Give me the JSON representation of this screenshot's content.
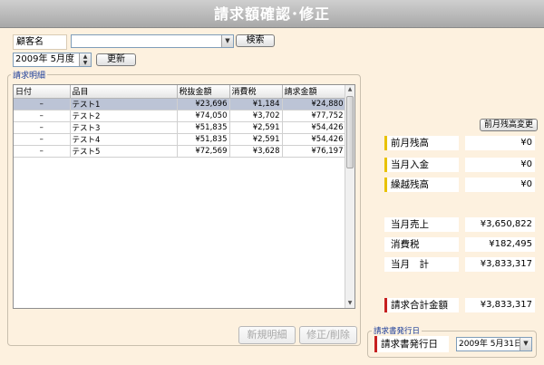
{
  "window": {
    "title": "請求額確認･修正"
  },
  "customer": {
    "label": "顧客名",
    "value": "",
    "search_button": "検索"
  },
  "period": {
    "value": "2009年 5月度",
    "refresh_button": "更新"
  },
  "detail": {
    "legend": "請求明細",
    "columns": [
      "日付",
      "品目",
      "税抜金額",
      "消費税",
      "請求金額"
    ],
    "rows": [
      {
        "date": "–",
        "item": "テスト1",
        "net": "¥23,696",
        "tax": "¥1,184",
        "total": "¥24,880"
      },
      {
        "date": "–",
        "item": "テスト2",
        "net": "¥74,050",
        "tax": "¥3,702",
        "total": "¥77,752"
      },
      {
        "date": "–",
        "item": "テスト3",
        "net": "¥51,835",
        "tax": "¥2,591",
        "total": "¥54,426"
      },
      {
        "date": "–",
        "item": "テスト4",
        "net": "¥51,835",
        "tax": "¥2,591",
        "total": "¥54,426"
      },
      {
        "date": "–",
        "item": "テスト5",
        "net": "¥72,569",
        "tax": "¥3,628",
        "total": "¥76,197"
      }
    ],
    "new_button": "新規明細",
    "edit_button": "修正/削除"
  },
  "summary": {
    "change_button": "前月残高変更",
    "prev_balance": {
      "label": "前月残高",
      "value": "¥0"
    },
    "payment": {
      "label": "当月入金",
      "value": "¥0"
    },
    "carryover": {
      "label": "繰越残高",
      "value": "¥0"
    },
    "sales": {
      "label": "当月売上",
      "value": "¥3,650,822"
    },
    "tax": {
      "label": "消費税",
      "value": "¥182,495"
    },
    "month_total": {
      "label": "当月　計",
      "value": "¥3,833,317"
    },
    "invoice_total": {
      "label": "請求合計金額",
      "value": "¥3,833,317"
    }
  },
  "issue": {
    "legend": "請求書発行日",
    "label": "請求書発行日",
    "date": "2009年 5月31日"
  },
  "colors": {
    "accent_yellow": "#e8c200",
    "accent_red": "#c62020",
    "selection": "#bcc4d6",
    "background": "#fdf1df"
  }
}
